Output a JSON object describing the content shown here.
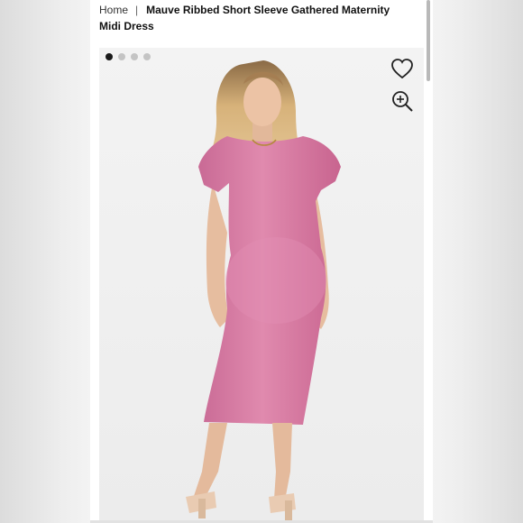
{
  "breadcrumb": {
    "home": "Home",
    "separator": "|",
    "current": "Mauve Ribbed Short Sleeve Gathered Maternity Midi Dress"
  },
  "gallery": {
    "image_count": 4,
    "active_index": 0,
    "icons": {
      "favorite": "heart-outline-icon",
      "zoom": "zoom-in-icon"
    }
  },
  "colors": {
    "dress": "#d97da6",
    "background": "#f1f1f1",
    "active_dot": "#1a1a1a",
    "inactive_dot": "#c4c4c4"
  }
}
